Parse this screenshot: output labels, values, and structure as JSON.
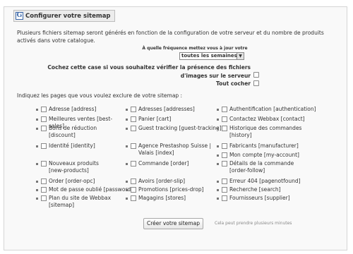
{
  "legend": "Configurer votre sitemap",
  "intro": "Plusieurs fichiers sitemap seront générés en fonction de la configuration de votre serveur et du nombre de produits activés dans votre catalogue.",
  "frequency": {
    "label": "À quelle fréquence mettez vous à jour votre boutique?",
    "value": "toutes les semaines"
  },
  "image_check_label": "Cochez cette case si vous souhaitez vérifier la présence des fichiers d'images sur le serveur",
  "check_all_label": "Tout cocher",
  "exclude_title": "Indiquez les pages que vous voulez exclure de votre sitemap :",
  "columns": [
    [
      "Adresse [address]",
      "Meilleures ventes [best-sales]",
      "Bons de réduction [discount]",
      "Identité [identity]",
      "Nouveaux produits [new-products]",
      "Order [order-opc]",
      "Mot de passe oublié [password]",
      "Plan du site de Webbax [sitemap]"
    ],
    [
      "Adresses [addresses]",
      "Panier [cart]",
      "Guest tracking [guest-tracking]",
      "Agence Prestashop Suisse | Valais [index]",
      "Commande [order]",
      "Avoirs [order-slip]",
      "Promotions [prices-drop]",
      "Magagins [stores]"
    ],
    [
      "Authentification [authentication]",
      "Contactez Webbax [contact]",
      "Historique des commandes [history]",
      "Fabricants [manufacturer]",
      "Mon compte [my-account]",
      "Détails de la commande [order-follow]",
      "Erreur 404 [pagenotfound]",
      "Recherche [search]",
      "Fournisseurs [supplier]"
    ]
  ],
  "submit_label": "Créer votre sitemap",
  "submit_note": "Cela peut prendre plusieurs minutes"
}
